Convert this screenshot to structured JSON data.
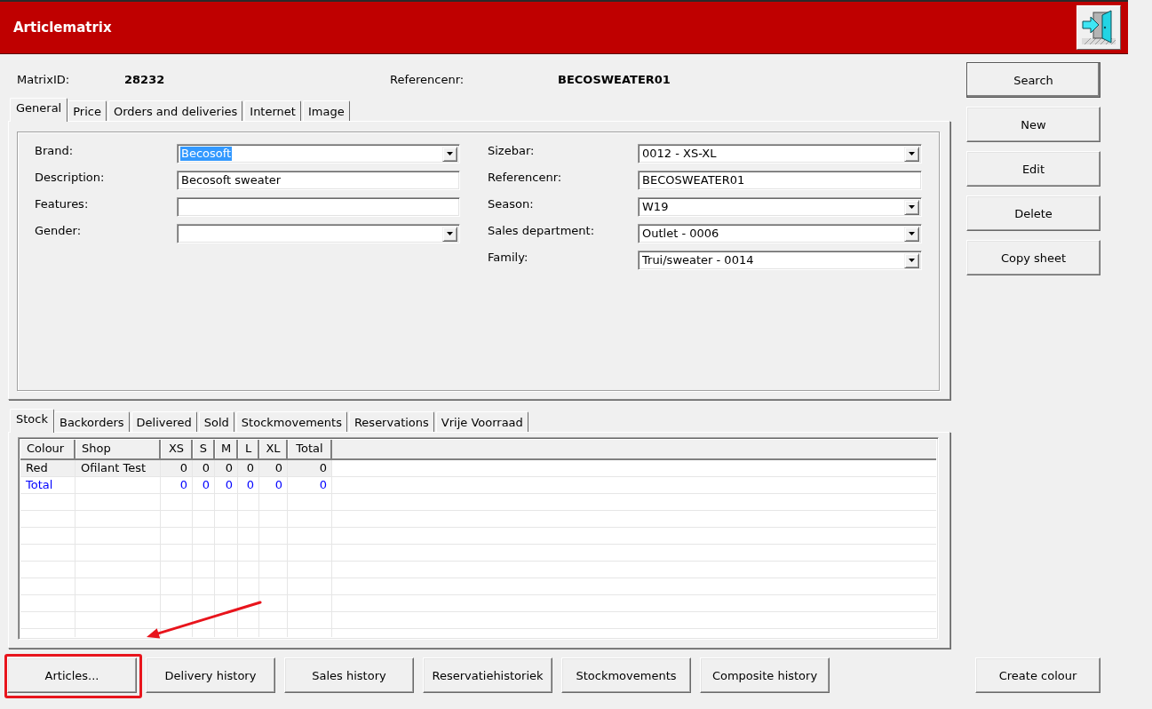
{
  "window": {
    "title": "Articlematrix"
  },
  "header": {
    "fields": [
      {
        "label": "MatrixID:",
        "value": "28232"
      },
      {
        "label": "Referencenr:",
        "value": "BECOSWEATER01"
      }
    ]
  },
  "tabs": [
    {
      "label": "General",
      "selected": true
    },
    {
      "label": "Price",
      "selected": false
    },
    {
      "label": "Orders and deliveries",
      "selected": false
    },
    {
      "label": "Internet",
      "selected": false
    },
    {
      "label": "Image",
      "selected": false
    }
  ],
  "form": {
    "left": [
      {
        "label": "Brand:",
        "kind": "combo",
        "value": "Becosoft",
        "text_selected": true
      },
      {
        "label": "Description:",
        "kind": "text",
        "value": "Becosoft sweater",
        "text_selected": false
      },
      {
        "label": "Features:",
        "kind": "text"
      },
      {
        "label": "Gender:",
        "kind": "combo"
      }
    ],
    "right": [
      {
        "label": "Sizebar:",
        "kind": "combo",
        "value": "0012 - XS-XL",
        "text_selected": false
      },
      {
        "label": "Referencenr:",
        "kind": "text",
        "value": "BECOSWEATER01",
        "text_selected": false
      },
      {
        "label": "Season:",
        "kind": "combo",
        "value": "W19",
        "text_selected": false
      },
      {
        "label": "Sales department:",
        "kind": "combo",
        "value": "Outlet - 0006",
        "text_selected": false
      },
      {
        "label": "Family:",
        "kind": "combo",
        "value": "Trui/sweater - 0014",
        "text_selected": false
      }
    ]
  },
  "side_buttons": [
    {
      "label": "Search",
      "default": true
    },
    {
      "label": "New",
      "default": false
    },
    {
      "label": "Edit",
      "default": false
    },
    {
      "label": "Delete",
      "default": false
    },
    {
      "label": "Copy sheet",
      "default": false
    }
  ],
  "stock_tabs": [
    {
      "label": "Stock",
      "selected": true
    },
    {
      "label": "Backorders",
      "selected": false
    },
    {
      "label": "Delivered",
      "selected": false
    },
    {
      "label": "Sold",
      "selected": false
    },
    {
      "label": "Stockmovements",
      "selected": false
    },
    {
      "label": "Reservations",
      "selected": false
    },
    {
      "label": "Vrije Voorraad",
      "selected": false
    }
  ],
  "stock_grid": {
    "columns": [
      "Colour",
      "Shop",
      "XS",
      "S",
      "M",
      "L",
      "XL",
      "Total"
    ],
    "rows": [
      {
        "kind": "data",
        "selected": true,
        "cells": [
          "Red",
          "Ofilant Test",
          "0",
          "0",
          "0",
          "0",
          "0",
          "0"
        ]
      },
      {
        "kind": "total",
        "selected": false,
        "cells": [
          "Total",
          null,
          "0",
          "0",
          "0",
          "0",
          "0",
          "0"
        ]
      }
    ]
  },
  "bottom_bar": {
    "buttons": [
      {
        "label": "Articles...",
        "highlighted": true
      },
      {
        "label": "Delivery history",
        "highlighted": false
      },
      {
        "label": "Sales history",
        "highlighted": false
      },
      {
        "label": "Reservatiehistoriek",
        "highlighted": false
      },
      {
        "label": "Stockmovements",
        "highlighted": false
      },
      {
        "label": "Composite history",
        "highlighted": false
      }
    ],
    "right_button": {
      "label": "Create colour"
    }
  },
  "annotation_arrow": true
}
